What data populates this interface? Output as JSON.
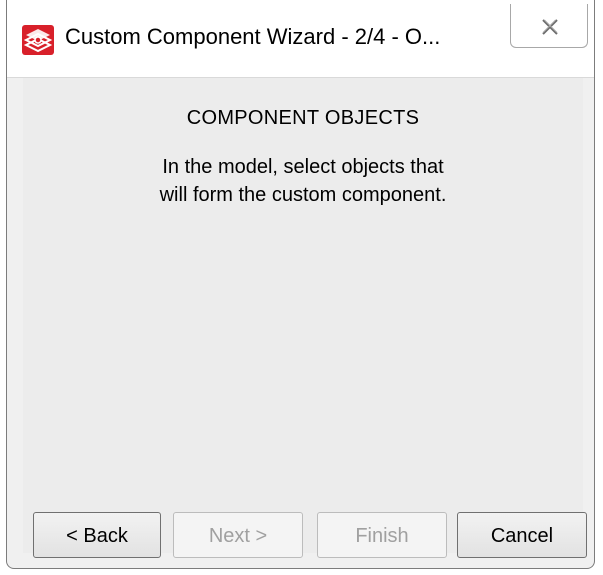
{
  "window": {
    "title": "Custom Component Wizard - 2/4 - O...",
    "icon": "custom-component-app-icon",
    "close_icon": "close-icon"
  },
  "content": {
    "heading": "COMPONENT OBJECTS",
    "instruction_line1": "In the model, select objects that",
    "instruction_line2": "will form the custom component."
  },
  "buttons": {
    "back": {
      "label": "< Back",
      "enabled": true
    },
    "next": {
      "label": "Next >",
      "enabled": false
    },
    "finish": {
      "label": "Finish",
      "enabled": false
    },
    "cancel": {
      "label": "Cancel",
      "enabled": true
    }
  },
  "colors": {
    "brand": "#d8202a",
    "dialog_background": "#ececec",
    "disabled_text": "#a0a0a0"
  }
}
